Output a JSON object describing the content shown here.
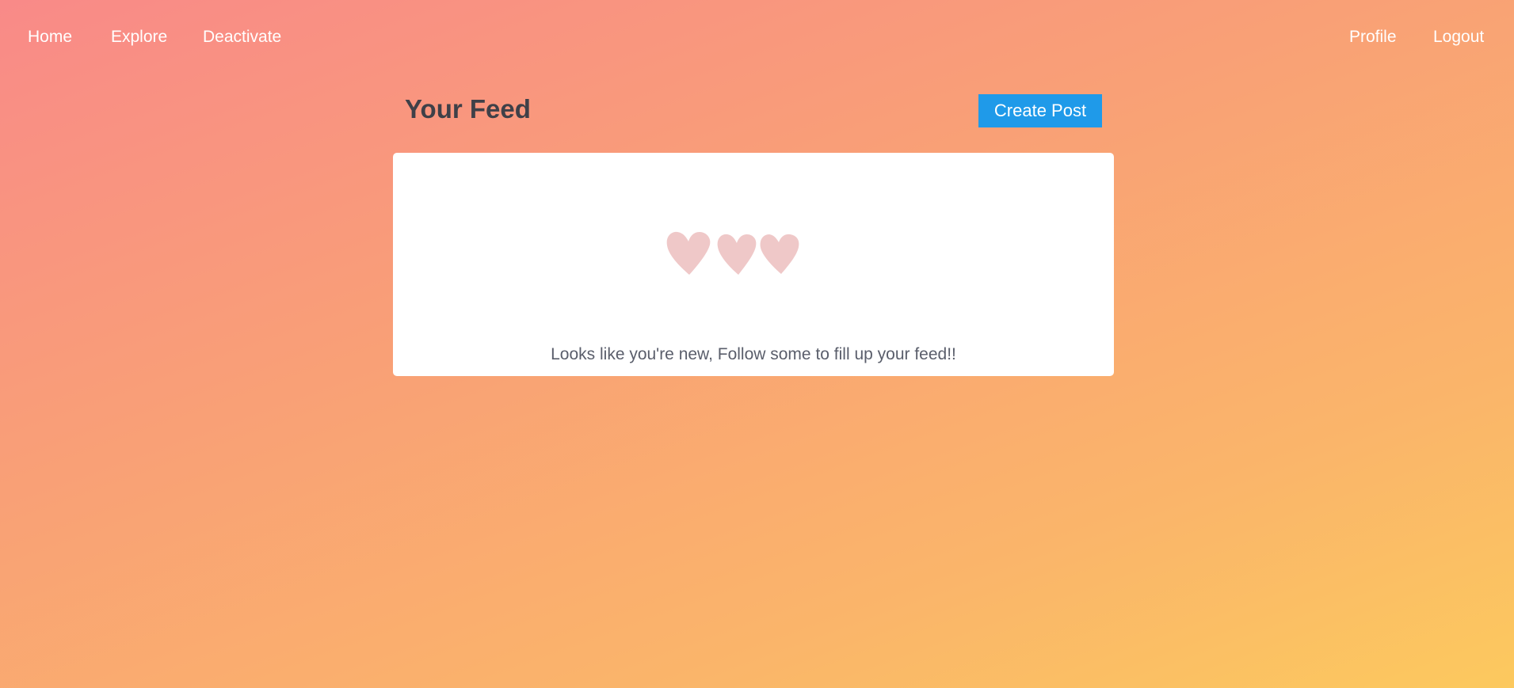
{
  "nav": {
    "left": [
      {
        "label": "Home"
      },
      {
        "label": "Explore"
      },
      {
        "label": "Deactivate"
      }
    ],
    "right": [
      {
        "label": "Profile"
      },
      {
        "label": "Logout"
      }
    ]
  },
  "feed": {
    "title": "Your Feed",
    "create_post_label": "Create Post",
    "empty_icon": "hearts-icon",
    "empty_message": "Looks like you're new, Follow some to fill up your feed!!"
  },
  "colors": {
    "accent_button": "#1f9ae9",
    "title_text": "#3f4048",
    "heart_fill": "#efc8c8"
  }
}
